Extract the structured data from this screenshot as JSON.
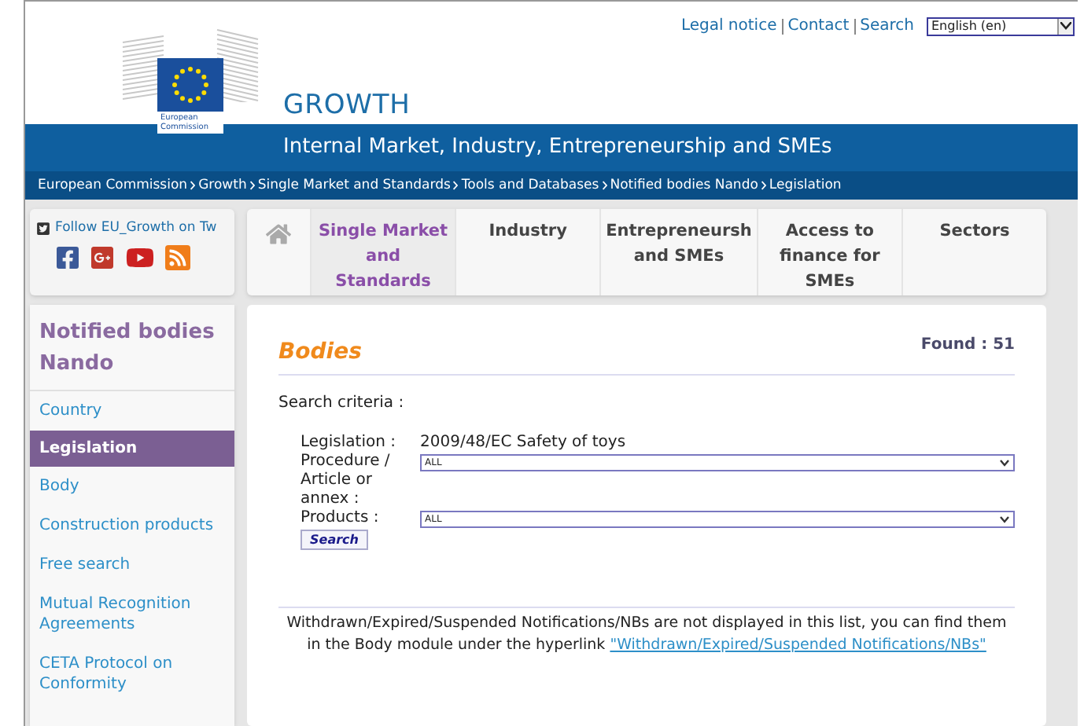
{
  "top_links": [
    "Legal notice",
    "Contact",
    "Search"
  ],
  "language": {
    "value": "English (en)"
  },
  "logo": {
    "label": "European Commission"
  },
  "site": {
    "title": "GROWTH",
    "subtitle": "Internal Market, Industry, Entrepreneurship and SMEs"
  },
  "breadcrumb": [
    "European Commission",
    "Growth",
    "Single Market and Standards",
    "Tools and Databases",
    "Notified bodies Nando",
    "Legislation"
  ],
  "social": {
    "follow": "Follow EU_Growth on Tw"
  },
  "nav": [
    {
      "label": "Single Market and Standards",
      "selected": true
    },
    {
      "label": "Industry",
      "selected": false
    },
    {
      "label": "Entrepreneursh and SMEs",
      "selected": false
    },
    {
      "label": "Access to finance for SMEs",
      "selected": false
    },
    {
      "label": "Sectors",
      "selected": false
    }
  ],
  "sidebar": {
    "title": "Notified bodies Nando",
    "items": [
      {
        "label": "Country",
        "selected": false
      },
      {
        "label": "Legislation",
        "selected": true
      },
      {
        "label": "Body",
        "selected": false
      },
      {
        "label": "Construction products",
        "selected": false
      },
      {
        "label": "Free search",
        "selected": false
      },
      {
        "label": "Mutual Recognition Agreements",
        "selected": false
      },
      {
        "label": "CETA Protocol on Conformity",
        "selected": false
      }
    ]
  },
  "main": {
    "heading": "Bodies",
    "found": "Found : 51",
    "criteria_label": "Search criteria :",
    "legislation": {
      "label": "Legislation :",
      "value": "2009/48/EC Safety of toys"
    },
    "fields": [
      {
        "label": "Procedure / Article or annex :",
        "value": "ALL"
      },
      {
        "label": "Products :",
        "value": "ALL"
      }
    ],
    "search_button": "Search",
    "note": "Withdrawn/Expired/Suspended Notifications/NBs are not displayed in this list, you can find them in the Body module under the hyperlink",
    "note_link": "\"Withdrawn/Expired/Suspended Notifications/NBs\""
  }
}
